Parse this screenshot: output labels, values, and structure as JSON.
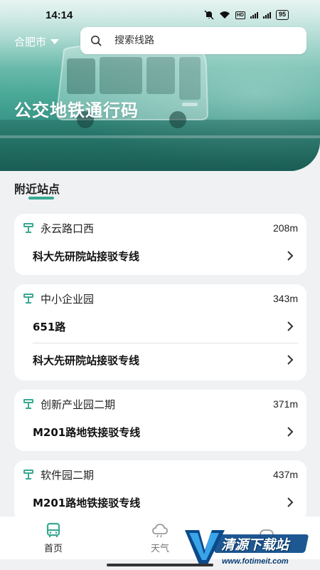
{
  "status_bar": {
    "time": "14:14",
    "battery": "95",
    "hd_badge": "HD"
  },
  "header": {
    "city": "合肥市",
    "search_placeholder": "搜索线路",
    "title": "公交地铁通行码"
  },
  "section": {
    "title": "附近站点"
  },
  "stations": [
    {
      "name": "永云路口西",
      "distance": "208m",
      "routes": [
        "科大先研院站接驳专线"
      ]
    },
    {
      "name": "中小企业园",
      "distance": "343m",
      "routes": [
        "651路",
        "科大先研院站接驳专线"
      ]
    },
    {
      "name": "创新产业园二期",
      "distance": "371m",
      "routes": [
        "M201路地铁接驳专线"
      ]
    },
    {
      "name": "软件园二期",
      "distance": "437m",
      "routes": [
        "M201路地铁接驳专线"
      ]
    }
  ],
  "bottom_nav": {
    "items": [
      {
        "label": "首页",
        "icon": "bus-icon",
        "active": true
      },
      {
        "label": "天气",
        "icon": "cloud-icon",
        "active": false
      },
      {
        "label": "",
        "icon": "smiley-icon",
        "active": false
      }
    ]
  },
  "watermark": {
    "title": "清源下载站",
    "url": "www.fotimeit.com"
  },
  "colors": {
    "accent": "#3aa893",
    "hero_dark": "#2c857a"
  }
}
